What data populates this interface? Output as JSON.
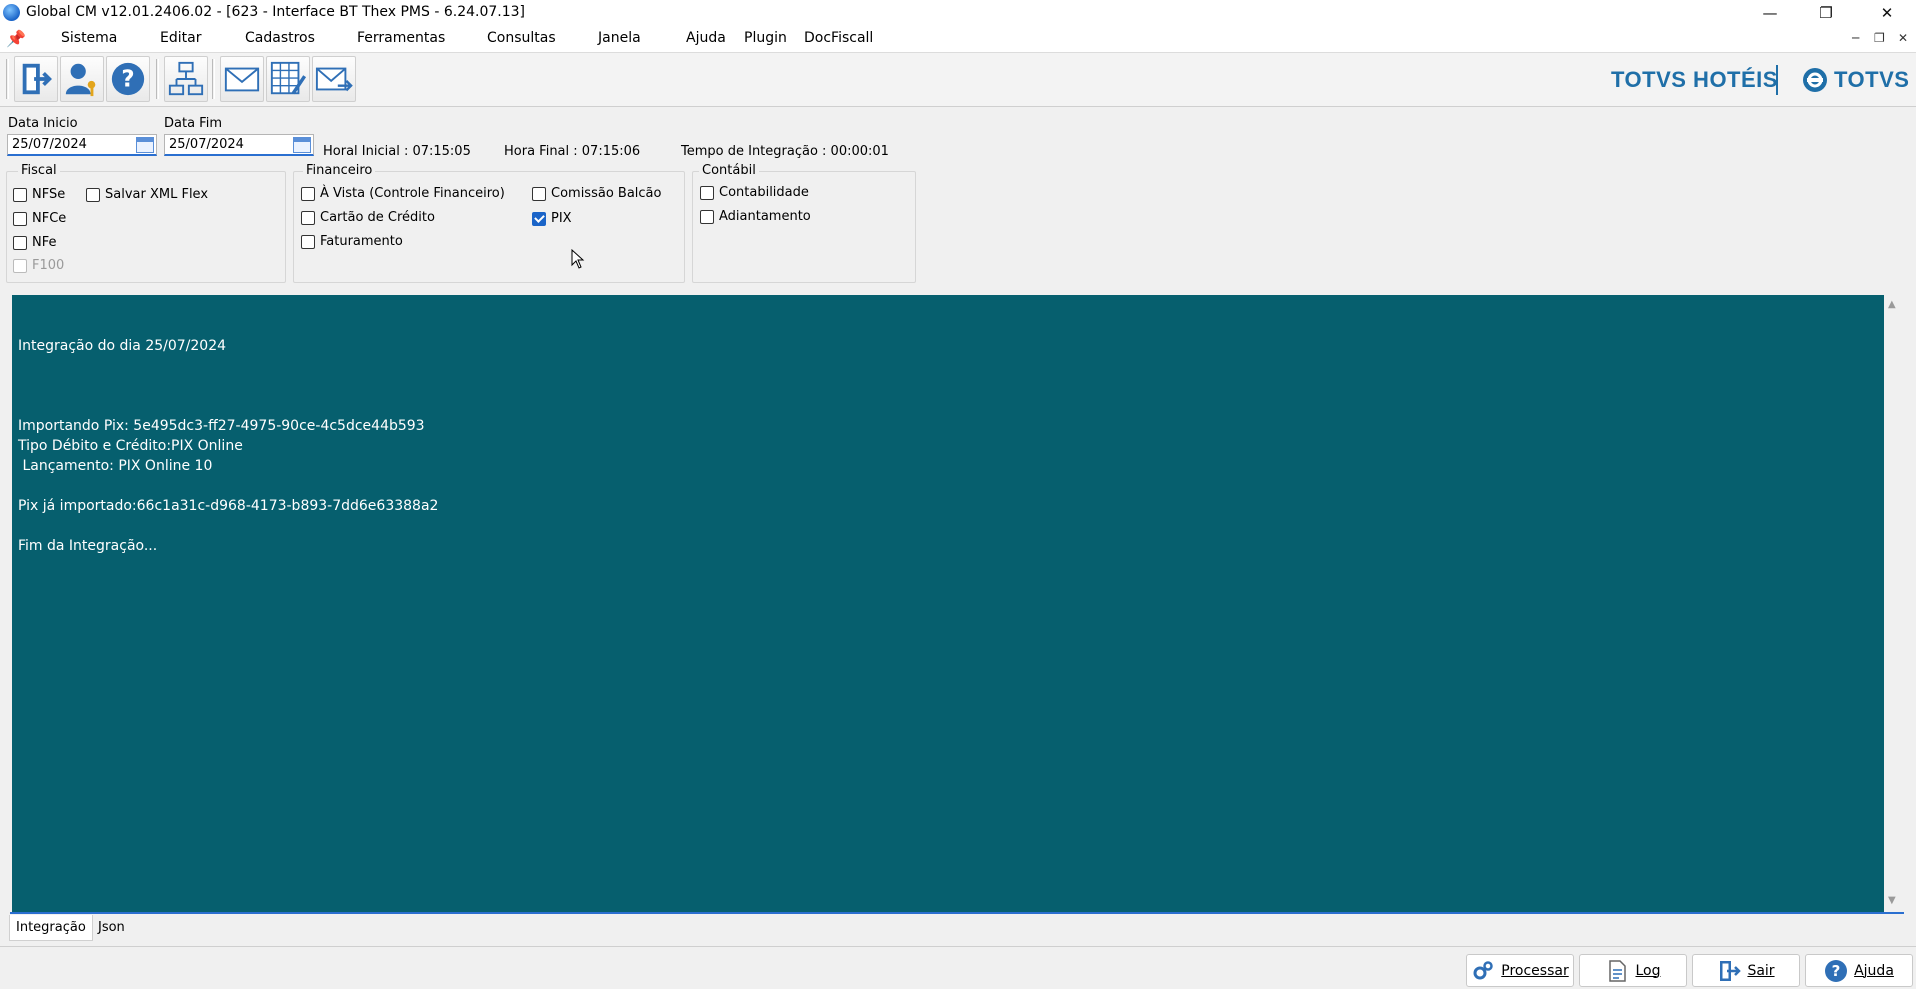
{
  "window": {
    "title": "Global CM v12.01.2406.02 - [623 - Interface BT Thex PMS - 6.24.07.13]"
  },
  "menu": {
    "items": [
      "Sistema",
      "Editar",
      "Cadastros",
      "Ferramentas",
      "Consultas",
      "Janela",
      "Ajuda",
      "Plugin",
      "DocFiscall"
    ]
  },
  "brand": {
    "hotels": "TOTVS HOTÉIS",
    "totvs": "TOTVS",
    "color": "#1f6fa8"
  },
  "filters": {
    "data_inicio_label": "Data Inicio",
    "data_inicio_value": "25/07/2024",
    "data_fim_label": "Data Fim",
    "data_fim_value": "25/07/2024",
    "hora_inicial": "Horal Inicial : 07:15:05",
    "hora_final": "Hora Final : 07:15:06",
    "tempo_integracao": "Tempo de Integração :  00:00:01"
  },
  "fiscal": {
    "title": "Fiscal",
    "nfse": "NFSe",
    "nfce": "NFCe",
    "nfe": "NFe",
    "f100": "F100",
    "salvar_xml": "Salvar XML Flex"
  },
  "financeiro": {
    "title": "Financeiro",
    "a_vista": "À Vista (Controle Financeiro)",
    "cartao": "Cartão de Crédito",
    "faturamento": "Faturamento",
    "comissao": "Comissão Balcão",
    "pix": "PIX"
  },
  "contabil": {
    "title": "Contábil",
    "contabilidade": "Contabilidade",
    "adiantamento": "Adiantamento"
  },
  "log": {
    "background": "#065f6e",
    "lines": [
      "Integração do dia 25/07/2024",
      "Importando Pix: 5e495dc3-ff27-4975-90ce-4c5dce44b593",
      "Tipo Débito e Crédito:PIX Online",
      " Lançamento: PIX Online 10",
      "Pix já importado:66c1a31c-d968-4173-b893-7dd6e63388a2",
      "Fim da Integração..."
    ]
  },
  "tabs": {
    "integracao": "Integração",
    "json": "Json"
  },
  "actions": {
    "processar": "Processar",
    "log": "Log",
    "sair": "Sair",
    "ajuda": "Ajuda"
  }
}
